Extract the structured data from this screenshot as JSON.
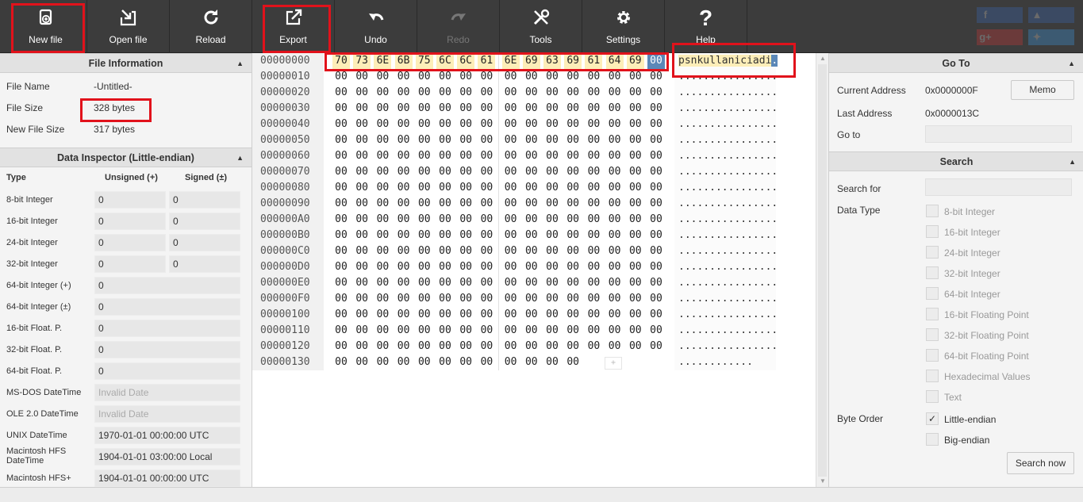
{
  "toolbar": {
    "new_file": "New file",
    "open_file": "Open file",
    "reload": "Reload",
    "export": "Export",
    "undo": "Undo",
    "redo": "Redo",
    "tools": "Tools",
    "settings": "Settings",
    "help": "Help"
  },
  "social": [
    "f",
    "g+",
    "like",
    "bird"
  ],
  "file_info": {
    "title": "File Information",
    "name_label": "File Name",
    "name_value": "-Untitled-",
    "size_label": "File Size",
    "size_value": "328 bytes",
    "new_size_label": "New File Size",
    "new_size_value": "317 bytes"
  },
  "inspector": {
    "title": "Data Inspector (Little-endian)",
    "col_type": "Type",
    "col_unsigned": "Unsigned (+)",
    "col_signed": "Signed (±)",
    "rows": [
      {
        "type": "8-bit Integer",
        "u": "0",
        "s": "0"
      },
      {
        "type": "16-bit Integer",
        "u": "0",
        "s": "0"
      },
      {
        "type": "24-bit Integer",
        "u": "0",
        "s": "0"
      },
      {
        "type": "32-bit Integer",
        "u": "0",
        "s": "0"
      },
      {
        "type": "64-bit Integer (+)",
        "v": "0"
      },
      {
        "type": "64-bit Integer (±)",
        "v": "0"
      },
      {
        "type": "16-bit Float. P.",
        "v": "0"
      },
      {
        "type": "32-bit Float. P.",
        "v": "0"
      },
      {
        "type": "64-bit Float. P.",
        "v": "0"
      },
      {
        "type": "MS-DOS DateTime",
        "v": "Invalid Date",
        "ph": true
      },
      {
        "type": "OLE 2.0 DateTime",
        "v": "Invalid Date",
        "ph": true
      },
      {
        "type": "UNIX DateTime",
        "v": "1970-01-01 00:00:00 UTC"
      },
      {
        "type": "Macintosh HFS DateTime",
        "v": "1904-01-01 03:00:00 Local"
      },
      {
        "type": "Macintosh HFS+",
        "v": "1904-01-01 00:00:00 UTC"
      }
    ]
  },
  "hex": {
    "offsets": [
      "00000000",
      "00000010",
      "00000020",
      "00000030",
      "00000040",
      "00000050",
      "00000060",
      "00000070",
      "00000080",
      "00000090",
      "000000A0",
      "000000B0",
      "000000C0",
      "000000D0",
      "000000E0",
      "000000F0",
      "00000100",
      "00000110",
      "00000120",
      "00000130"
    ],
    "first_row": [
      "70",
      "73",
      "6E",
      "6B",
      "75",
      "6C",
      "6C",
      "61",
      "6E",
      "69",
      "63",
      "69",
      "61",
      "64",
      "69",
      "00"
    ],
    "zero_byte": "00",
    "last_row_count": 12,
    "plus": "+",
    "first_ascii": "psnkullaniciadi",
    "first_ascii_cursor": ".",
    "dot_row": "................",
    "last_dot_row": "............"
  },
  "goto": {
    "title": "Go To",
    "current_label": "Current Address",
    "current_value": "0x0000000F",
    "last_label": "Last Address",
    "last_value": "0x0000013C",
    "goto_label": "Go to",
    "memo": "Memo"
  },
  "search": {
    "title": "Search",
    "for_label": "Search for",
    "type_label": "Data Type",
    "types": [
      "8-bit Integer",
      "16-bit Integer",
      "24-bit Integer",
      "32-bit Integer",
      "64-bit Integer",
      "16-bit Floating Point",
      "32-bit Floating Point",
      "64-bit Floating Point",
      "Hexadecimal Values",
      "Text"
    ],
    "order_label": "Byte Order",
    "little": "Little-endian",
    "big": "Big-endian",
    "check": "✓",
    "search_now": "Search now"
  }
}
